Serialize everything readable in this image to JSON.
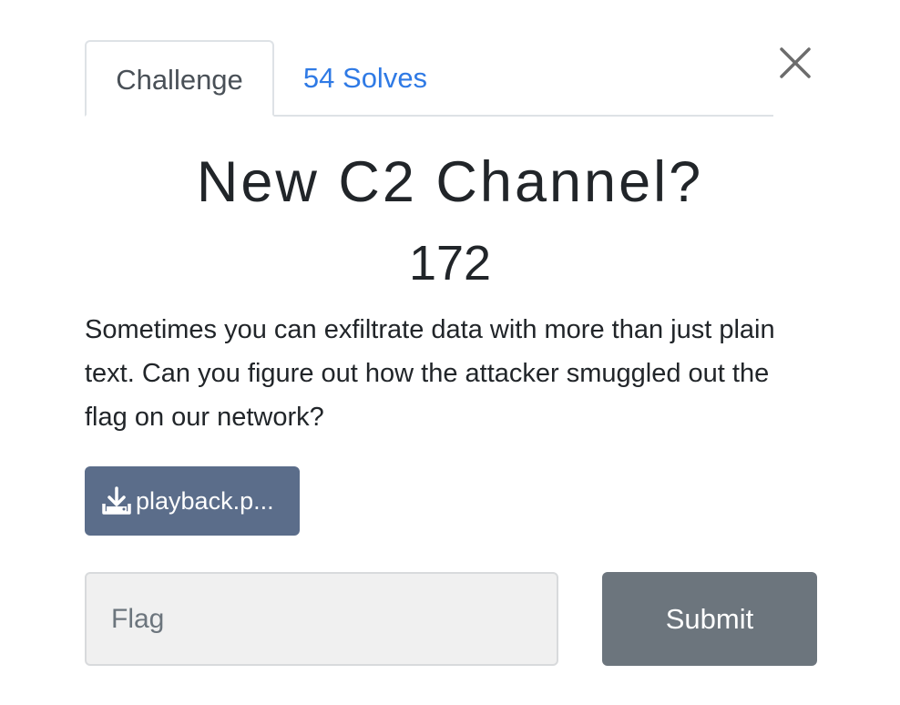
{
  "tabs": [
    {
      "label": "Challenge",
      "active": true
    },
    {
      "label": "54 Solves",
      "active": false
    }
  ],
  "challenge": {
    "name": "New C2 Channel?",
    "points": "172",
    "description": "Sometimes you can exfiltrate data with more than just plain text. Can you figure out how the attacker smuggled out the flag on our network?"
  },
  "file": {
    "label": "playback.p...",
    "icon": "download-icon"
  },
  "flag_input": {
    "placeholder": "Flag",
    "value": ""
  },
  "submit": {
    "label": "Submit"
  },
  "close": {
    "icon": "close-icon"
  },
  "colors": {
    "link": "#2f7ae5",
    "file_button": "#5b6d8a",
    "submit_button": "#6c757d",
    "text": "#212529"
  }
}
